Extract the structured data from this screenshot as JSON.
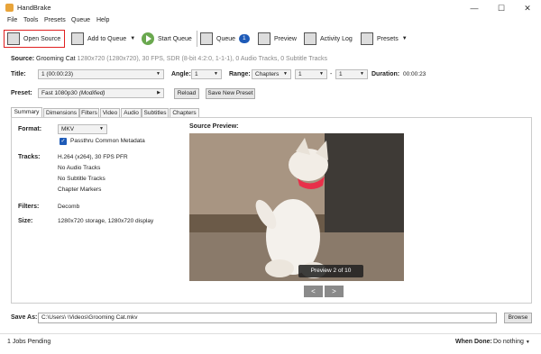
{
  "window": {
    "title": "HandBrake",
    "minimize": "—",
    "maximize": "☐",
    "close": "✕"
  },
  "menu": [
    "File",
    "Tools",
    "Presets",
    "Queue",
    "Help"
  ],
  "toolbar": {
    "open_source": "Open Source",
    "add_to_queue": "Add to Queue",
    "start_queue": "Start Queue",
    "queue": "Queue",
    "queue_count": "1",
    "preview": "Preview",
    "activity_log": "Activity Log",
    "presets": "Presets"
  },
  "source": {
    "label": "Source:",
    "name": "Grooming Cat",
    "detail": "1280x720 (1280x720), 30 FPS, SDR (8-bit 4:2:0, 1-1-1), 0 Audio Tracks, 0 Subtitle Tracks"
  },
  "title_row": {
    "title_label": "Title:",
    "title_value": "1 (00:00:23)",
    "angle_label": "Angle:",
    "angle_value": "1",
    "range_label": "Range:",
    "range_type": "Chapters",
    "range_start": "1",
    "range_dash": "-",
    "range_end": "1",
    "duration_label": "Duration:",
    "duration_value": "00:00:23"
  },
  "preset_row": {
    "label": "Preset:",
    "value": "Fast 1080p30",
    "modified": "(Modified)",
    "reload": "Reload",
    "save_new": "Save New Preset"
  },
  "tabs": [
    "Summary",
    "Dimensions",
    "Filters",
    "Video",
    "Audio",
    "Subtitles",
    "Chapters"
  ],
  "summary": {
    "format_label": "Format:",
    "format_value": "MKV",
    "passthru": "Passthru Common Metadata",
    "tracks_label": "Tracks:",
    "tracks": [
      "H.264 (x264), 30 FPS PFR",
      "No Audio Tracks",
      "No Subtitle Tracks",
      "Chapter Markers"
    ],
    "filters_label": "Filters:",
    "filters_value": "Decomb",
    "size_label": "Size:",
    "size_value": "1280x720 storage, 1280x720 display"
  },
  "preview": {
    "heading": "Source Preview:",
    "label": "Preview 2 of 10",
    "prev": "<",
    "next": ">"
  },
  "save": {
    "label": "Save As:",
    "path": "C:\\Users\\                    \\Videos\\Grooming Cat.mkv",
    "browse": "Browse"
  },
  "status": {
    "jobs": "1 Jobs Pending",
    "when_done_label": "When Done:",
    "when_done_value": "Do nothing"
  }
}
